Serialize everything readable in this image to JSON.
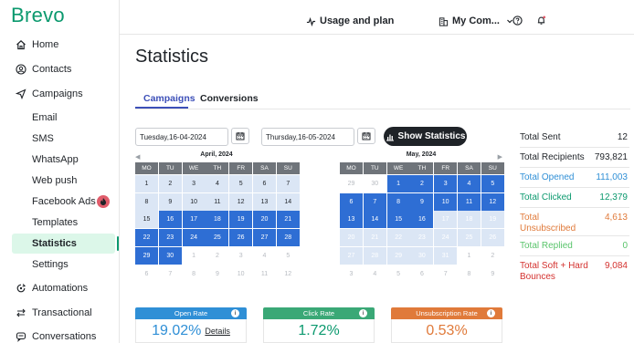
{
  "app": {
    "logo": "Brevo"
  },
  "sidebar": {
    "items": [
      {
        "label": "Home",
        "icon": "home-icon"
      },
      {
        "label": "Contacts",
        "icon": "contacts-icon"
      },
      {
        "label": "Campaigns",
        "icon": "send-icon"
      },
      {
        "label": "Email"
      },
      {
        "label": "SMS"
      },
      {
        "label": "WhatsApp"
      },
      {
        "label": "Web push"
      },
      {
        "label": "Facebook Ads",
        "badge_icon": "fire-icon"
      },
      {
        "label": "Templates"
      },
      {
        "label": "Statistics",
        "active": true
      },
      {
        "label": "Settings"
      },
      {
        "label": "Automations",
        "icon": "automations-icon"
      },
      {
        "label": "Transactional",
        "icon": "transfer-icon"
      },
      {
        "label": "Conversations",
        "icon": "chat-icon"
      }
    ]
  },
  "topbar": {
    "usage_label": "Usage and plan",
    "company_label": "My Com..."
  },
  "page": {
    "title": "Statistics",
    "tabs": [
      {
        "label": "Campaigns",
        "active": true
      },
      {
        "label": "Conversions",
        "active": false
      }
    ]
  },
  "date_range": {
    "start": "Tuesday,16-04-2024",
    "end": "Thursday,16-05-2024",
    "show_button": "Show Statistics"
  },
  "calendars": [
    {
      "title": "April, 2024",
      "dow": [
        "MO",
        "TU",
        "WE",
        "TH",
        "FR",
        "SA",
        "SU"
      ],
      "weeks": [
        [
          [
            "1",
            "light"
          ],
          [
            "2",
            "light"
          ],
          [
            "3",
            "light"
          ],
          [
            "4",
            "light"
          ],
          [
            "5",
            "light"
          ],
          [
            "6",
            "light"
          ],
          [
            "7",
            "light"
          ]
        ],
        [
          [
            "8",
            "light"
          ],
          [
            "9",
            "light"
          ],
          [
            "10",
            "light"
          ],
          [
            "11",
            "light"
          ],
          [
            "12",
            "light"
          ],
          [
            "13",
            "light"
          ],
          [
            "14",
            "light"
          ]
        ],
        [
          [
            "15",
            "light"
          ],
          [
            "16",
            "sel"
          ],
          [
            "17",
            "sel"
          ],
          [
            "18",
            "sel"
          ],
          [
            "19",
            "sel"
          ],
          [
            "20",
            "sel"
          ],
          [
            "21",
            "sel"
          ]
        ],
        [
          [
            "22",
            "sel"
          ],
          [
            "23",
            "sel"
          ],
          [
            "24",
            "sel"
          ],
          [
            "25",
            "sel"
          ],
          [
            "26",
            "sel"
          ],
          [
            "27",
            "sel"
          ],
          [
            "28",
            "sel"
          ]
        ],
        [
          [
            "29",
            "sel"
          ],
          [
            "30",
            "sel"
          ],
          [
            "1",
            "muted"
          ],
          [
            "2",
            "muted"
          ],
          [
            "3",
            "muted"
          ],
          [
            "4",
            "muted"
          ],
          [
            "5",
            "muted"
          ]
        ],
        [
          [
            "6",
            "muted"
          ],
          [
            "7",
            "muted"
          ],
          [
            "8",
            "muted"
          ],
          [
            "9",
            "muted"
          ],
          [
            "10",
            "muted"
          ],
          [
            "11",
            "muted"
          ],
          [
            "12",
            "muted"
          ]
        ]
      ]
    },
    {
      "title": "May, 2024",
      "dow": [
        "MO",
        "TU",
        "WE",
        "TH",
        "FR",
        "SA",
        "SU"
      ],
      "weeks": [
        [
          [
            "29",
            "muted"
          ],
          [
            "30",
            "muted"
          ],
          [
            "1",
            "sel"
          ],
          [
            "2",
            "sel"
          ],
          [
            "3",
            "sel"
          ],
          [
            "4",
            "sel"
          ],
          [
            "5",
            "sel"
          ]
        ],
        [
          [
            "6",
            "sel"
          ],
          [
            "7",
            "sel"
          ],
          [
            "8",
            "sel"
          ],
          [
            "9",
            "sel"
          ],
          [
            "10",
            "sel"
          ],
          [
            "11",
            "sel"
          ],
          [
            "12",
            "sel"
          ]
        ],
        [
          [
            "13",
            "sel"
          ],
          [
            "14",
            "sel"
          ],
          [
            "15",
            "sel"
          ],
          [
            "16",
            "sel"
          ],
          [
            "17",
            "range"
          ],
          [
            "18",
            "range"
          ],
          [
            "19",
            "range"
          ]
        ],
        [
          [
            "20",
            "range"
          ],
          [
            "21",
            "range"
          ],
          [
            "22",
            "range"
          ],
          [
            "23",
            "range"
          ],
          [
            "24",
            "range"
          ],
          [
            "25",
            "range"
          ],
          [
            "26",
            "range"
          ]
        ],
        [
          [
            "27",
            "range"
          ],
          [
            "28",
            "range"
          ],
          [
            "29",
            "range"
          ],
          [
            "30",
            "range"
          ],
          [
            "31",
            "range"
          ],
          [
            "1",
            "muted"
          ],
          [
            "2",
            "muted"
          ]
        ],
        [
          [
            "3",
            "muted"
          ],
          [
            "4",
            "muted"
          ],
          [
            "5",
            "muted"
          ],
          [
            "6",
            "muted"
          ],
          [
            "7",
            "muted"
          ],
          [
            "8",
            "muted"
          ],
          [
            "9",
            "muted"
          ]
        ]
      ]
    }
  ],
  "stats": [
    {
      "label": "Total Sent",
      "value": "12",
      "color": "#1f2328"
    },
    {
      "label": "Total Recipients",
      "value": "793,821",
      "color": "#1f2328"
    },
    {
      "label": "Total Opened",
      "value": "111,003",
      "color": "#2f8fd6"
    },
    {
      "label": "Total Clicked",
      "value": "12,379",
      "color": "#0b996e"
    },
    {
      "label": "Total Unsubscribed",
      "value": "4,613",
      "color": "#e07a3a"
    },
    {
      "label": "Total Replied",
      "value": "0",
      "color": "#59c46b"
    },
    {
      "label": "Total Soft + Hard Bounces",
      "value": "9,084",
      "color": "#d4322f"
    }
  ],
  "kpis": [
    {
      "label": "Open Rate",
      "value": "19.02%",
      "details": "Details",
      "color": "#2f8fd6",
      "value_color": "#2f8fd6"
    },
    {
      "label": "Click Rate",
      "value": "1.72%",
      "color": "#3aa876",
      "value_color": "#0b996e"
    },
    {
      "label": "Unsubscription Rate",
      "value": "0.53%",
      "color": "#e07a3a",
      "value_color": "#e07a3a"
    }
  ]
}
